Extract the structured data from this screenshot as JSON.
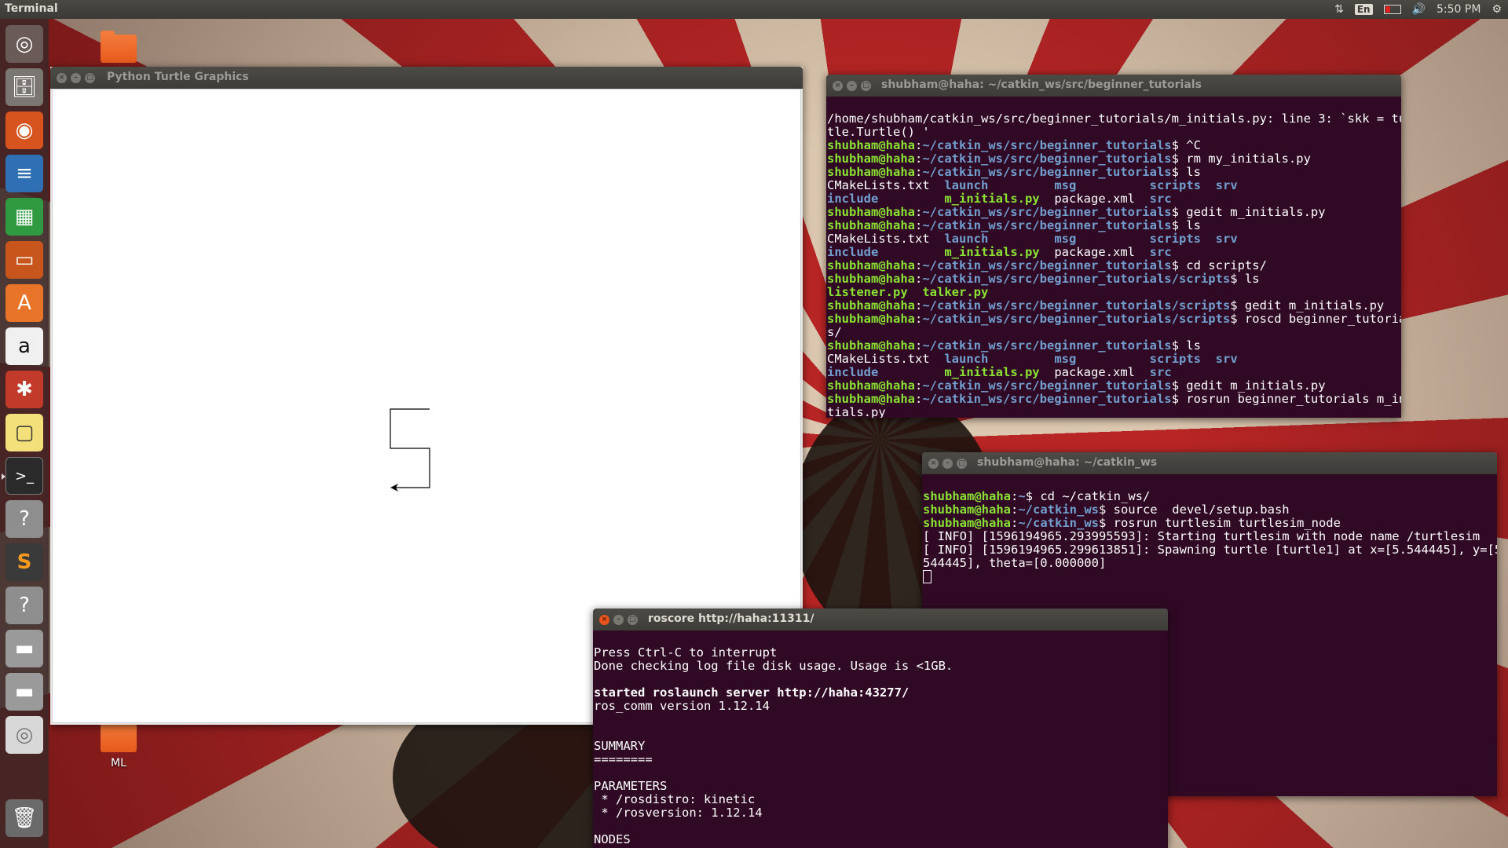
{
  "panel": {
    "app_title": "Terminal",
    "keyboard": "En",
    "clock": "5:50 PM"
  },
  "desktop": {
    "folder_ml_label": "ML"
  },
  "launcher": {
    "items": [
      "dash-icon",
      "files-icon",
      "firefox-icon",
      "writer-icon",
      "calc-icon",
      "impress-icon",
      "software-center-icon",
      "amazon-icon",
      "system-settings-icon",
      "notes-icon",
      "terminal-icon",
      "unknown-app-icon",
      "sublime-text-icon",
      "unknown-app-icon",
      "disk-icon",
      "disk-icon",
      "dvd-icon",
      "trash-icon"
    ]
  },
  "turtle_window": {
    "title": "Python Turtle Graphics"
  },
  "term1": {
    "title": "shubham@haha: ~/catkin_ws/src/beginner_tutorials",
    "user": "shubham@haha",
    "path": "~/catkin_ws/src/beginner_tutorials",
    "path_scripts": "~/catkin_ws/src/beginner_tutorials/scripts",
    "error_line1": "/home/shubham/catkin_ws/src/beginner_tutorials/m_initials.py: line 3: `skk = tur",
    "error_line2": "tle.Turtle() '",
    "cmd_ctrlc": "$ ^C",
    "cmd_rm": "$ rm my_initials.py",
    "cmd_ls": "$ ls",
    "cmd_gedit": "$ gedit m_initials.py",
    "cmd_cd": "$ cd scripts/",
    "cmd_roscd": "$ roscd beginner_tutorial",
    "roscd_wrap": "s/",
    "cmd_rosrun": "$ rosrun beginner_tutorials m_ini",
    "rosrun_wrap": "tials.py",
    "ls_cmake": "CMakeLists.txt",
    "ls_launch": "launch",
    "ls_msg": "msg",
    "ls_scripts": "scripts",
    "ls_srv": "srv",
    "ls_include": "include",
    "ls_minitials": "m_initials.py",
    "ls_package": "package.xml",
    "ls_src": "src",
    "ls_listener": "listener.py",
    "ls_talker": "talker.py"
  },
  "term2": {
    "title": "shubham@haha: ~/catkin_ws",
    "user": "shubham@haha",
    "home": "~",
    "ws": "~/catkin_ws",
    "cmd_cd": "$ cd ~/catkin_ws/",
    "cmd_source": "$ source  devel/setup.bash",
    "cmd_rosrun": "$ rosrun turtlesim turtlesim_node",
    "info1": "[ INFO] [1596194965.293995593]: Starting turtlesim with node name /turtlesim",
    "info2": "[ INFO] [1596194965.299613851]: Spawning turtle [turtle1] at x=[5.544445], y=[5.",
    "info3": "544445], theta=[0.000000]"
  },
  "term3": {
    "title": "roscore http://haha:11311/",
    "lines": [
      "Press Ctrl-C to interrupt",
      "Done checking log file disk usage. Usage is <1GB.",
      "",
      "started roslaunch server http://haha:43277/",
      "ros_comm version 1.12.14",
      "",
      "",
      "SUMMARY",
      "========",
      "",
      "PARAMETERS",
      " * /rosdistro: kinetic",
      " * /rosversion: 1.12.14",
      "",
      "NODES"
    ]
  }
}
